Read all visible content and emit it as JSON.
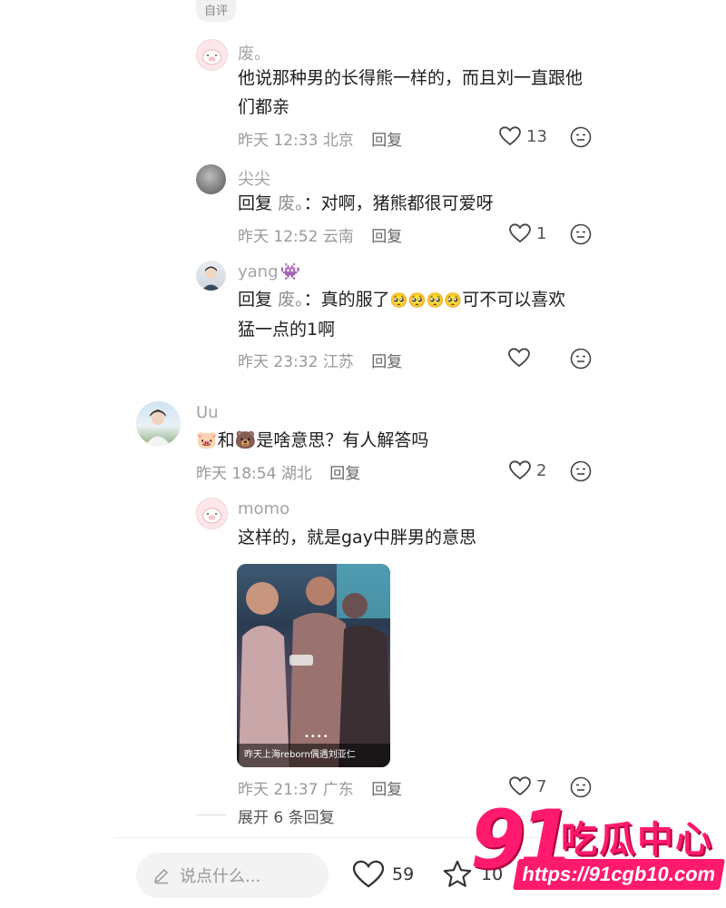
{
  "top_tag": "自评",
  "comments": [
    {
      "username": "废。",
      "content": "他说那种男的长得熊一样的，而且刘一直跟他们都亲",
      "content_lines": [
        "他说那种男的长得熊一样的，而且刘一直跟他",
        "们都亲"
      ],
      "time": "昨天 12:33",
      "location": "北京",
      "reply_label": "回复",
      "likes": "13"
    },
    {
      "username": "尖尖",
      "reply_prefix": "回复",
      "mention": "废。",
      "text": "：对啊，猪熊都很可爱呀",
      "time": "昨天 12:52",
      "location": "云南",
      "reply_label": "回复",
      "likes": "1"
    },
    {
      "username": "yang",
      "username_emoji": "👾",
      "reply_prefix": "回复",
      "mention": "废。",
      "text_a": "：真的服了",
      "inline_emojis": "🥺🥺🥺🥺",
      "text_b": "可不可以喜欢",
      "text_line2": "猛一点的1啊",
      "time": "昨天 23:32",
      "location": "江苏",
      "reply_label": "回复",
      "likes": ""
    },
    {
      "username": "Uu",
      "emoji_pig": "🐷",
      "and": "和",
      "emoji_bear": "🐻",
      "text": "是啥意思？有人解答吗",
      "time": "昨天 18:54",
      "location": "湖北",
      "reply_label": "回复",
      "likes": "2"
    },
    {
      "username": "momo",
      "text": "这样的，就是gay中胖男的意思",
      "image_caption": "昨天上海reborn偶遇刘亚仁",
      "image_dots": "••••",
      "time": "昨天 21:37",
      "location": "广东",
      "reply_label": "回复",
      "likes": "7"
    }
  ],
  "expand_replies": "展开 6 条回复",
  "bottom_bar": {
    "input_placeholder": "说点什么...",
    "like_count": "59",
    "star_count": "10"
  },
  "watermark": {
    "number": "91",
    "text": "吃瓜中心",
    "url": "https://91cgb10.com"
  },
  "colors": {
    "watermark": "#ff1a6e",
    "username": "#a4a4a4",
    "meta": "#999999"
  }
}
